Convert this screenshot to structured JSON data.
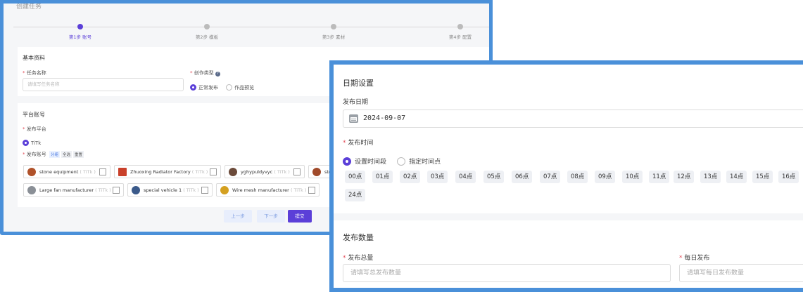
{
  "back": {
    "title": "创建任务",
    "steps": [
      "第1步 账号",
      "第2步 模板",
      "第3步 素材",
      "第4步 配置"
    ],
    "basic": {
      "title": "基本资料",
      "task_name_label": "任务名称",
      "task_name_placeholder": "请填写任务名称",
      "type_label": "创作类型",
      "type_options": [
        "正常发布",
        "作品预览"
      ]
    },
    "platform": {
      "title": "平台账号",
      "platform_label": "发布平台",
      "platform_value": "TiTk",
      "accounts_label": "发布账号",
      "group_btns": [
        "分组",
        "全选",
        "重置"
      ],
      "accounts": [
        {
          "name": "stone equipment",
          "plat": "( TiTk )"
        },
        {
          "name": "Zhuoxing Radiator Factory",
          "plat": "( TiTk )"
        },
        {
          "name": "yghypuldyvyc",
          "plat": "( TiTk )"
        },
        {
          "name": "sto",
          "plat": ""
        },
        {
          "name": "Large fan manufacturer",
          "plat": "( TiTk )"
        },
        {
          "name": "special vehicle 1",
          "plat": "( TiTk )"
        },
        {
          "name": "Wire mesh manufacturer",
          "plat": "( TiTk )"
        }
      ]
    },
    "buttons": {
      "prev": "上一步",
      "next": "下一步",
      "submit": "提交"
    }
  },
  "front": {
    "date_title": "日期设置",
    "publish_date_label": "发布日期",
    "publish_date_value": "2024-09-07",
    "publish_time_label": "发布时间",
    "time_options": [
      "设置时间段",
      "指定时间点"
    ],
    "hours": [
      "00点",
      "01点",
      "02点",
      "03点",
      "04点",
      "05点",
      "06点",
      "07点",
      "08点",
      "09点",
      "10点",
      "11点",
      "12点",
      "13点",
      "14点",
      "15点",
      "16点",
      "24点"
    ],
    "qty_title": "发布数量",
    "total_label": "发布总量",
    "total_placeholder": "请填写总发布数量",
    "daily_label": "每日发布",
    "daily_placeholder": "请填写每日发布数量"
  },
  "colors": {
    "accent": "#5b3fd8",
    "frame": "#4a90d9",
    "required": "#e34d59"
  }
}
